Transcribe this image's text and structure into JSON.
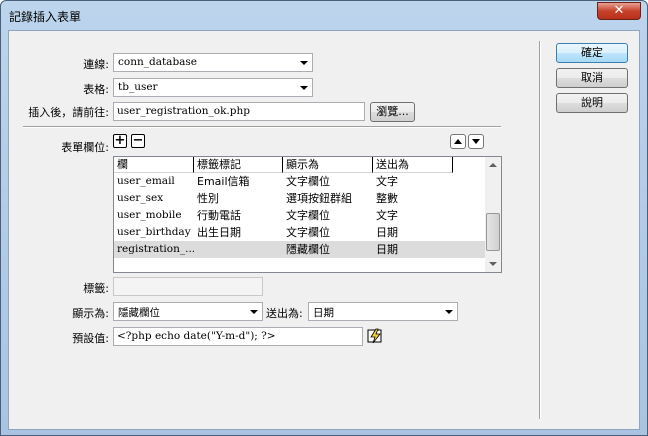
{
  "window": {
    "title": "記錄插入表單",
    "close_glyph": "✕"
  },
  "form": {
    "connection": {
      "label": "連線:",
      "value": "conn_database"
    },
    "table": {
      "label": "表格:",
      "value": "tb_user"
    },
    "after_insert": {
      "label": "插入後，請前往:",
      "value": "user_registration_ok.php",
      "browse_label": "瀏覽..."
    },
    "form_fields": {
      "label": "表單欄位:",
      "add_glyph": "+",
      "remove_glyph": "−",
      "columns": [
        "欄",
        "標籤標記",
        "顯示為",
        "送出為"
      ],
      "rows": [
        {
          "column": "user_email",
          "label": "Email信箱",
          "display": "文字欄位",
          "submit": "文字"
        },
        {
          "column": "user_sex",
          "label": "性別",
          "display": "選項按鈕群組",
          "submit": "整數"
        },
        {
          "column": "user_mobile",
          "label": "行動電話",
          "display": "文字欄位",
          "submit": "文字"
        },
        {
          "column": "user_birthday",
          "label": "出生日期",
          "display": "文字欄位",
          "submit": "日期"
        },
        {
          "column": "registration_...",
          "label": "",
          "display": "隱藏欄位",
          "submit": "日期"
        }
      ],
      "selected_row": 4
    },
    "label_field": {
      "label": "標籤:",
      "value": ""
    },
    "display_as": {
      "label": "顯示為:",
      "value": "隱藏欄位"
    },
    "submit_as": {
      "label": "送出為:",
      "value": "日期"
    },
    "default_value": {
      "label": "預設值:",
      "value": "<?php echo date(\"Y-m-d\"); ?>"
    }
  },
  "buttons": {
    "ok": "確定",
    "cancel": "取消",
    "help": "說明"
  },
  "icons": {
    "add": "plus-icon",
    "remove": "minus-icon",
    "move_up": "arrow-up-icon",
    "move_down": "arrow-down-icon",
    "dynamic_data": "lightning-icon",
    "close": "close-icon"
  },
  "colors": {
    "titlebar": "#bcd4ec",
    "client": "#f0f0f0",
    "selected_row": "#dcdcdc",
    "close_button": "#c7422c",
    "default_button": "#3c7fb1"
  }
}
